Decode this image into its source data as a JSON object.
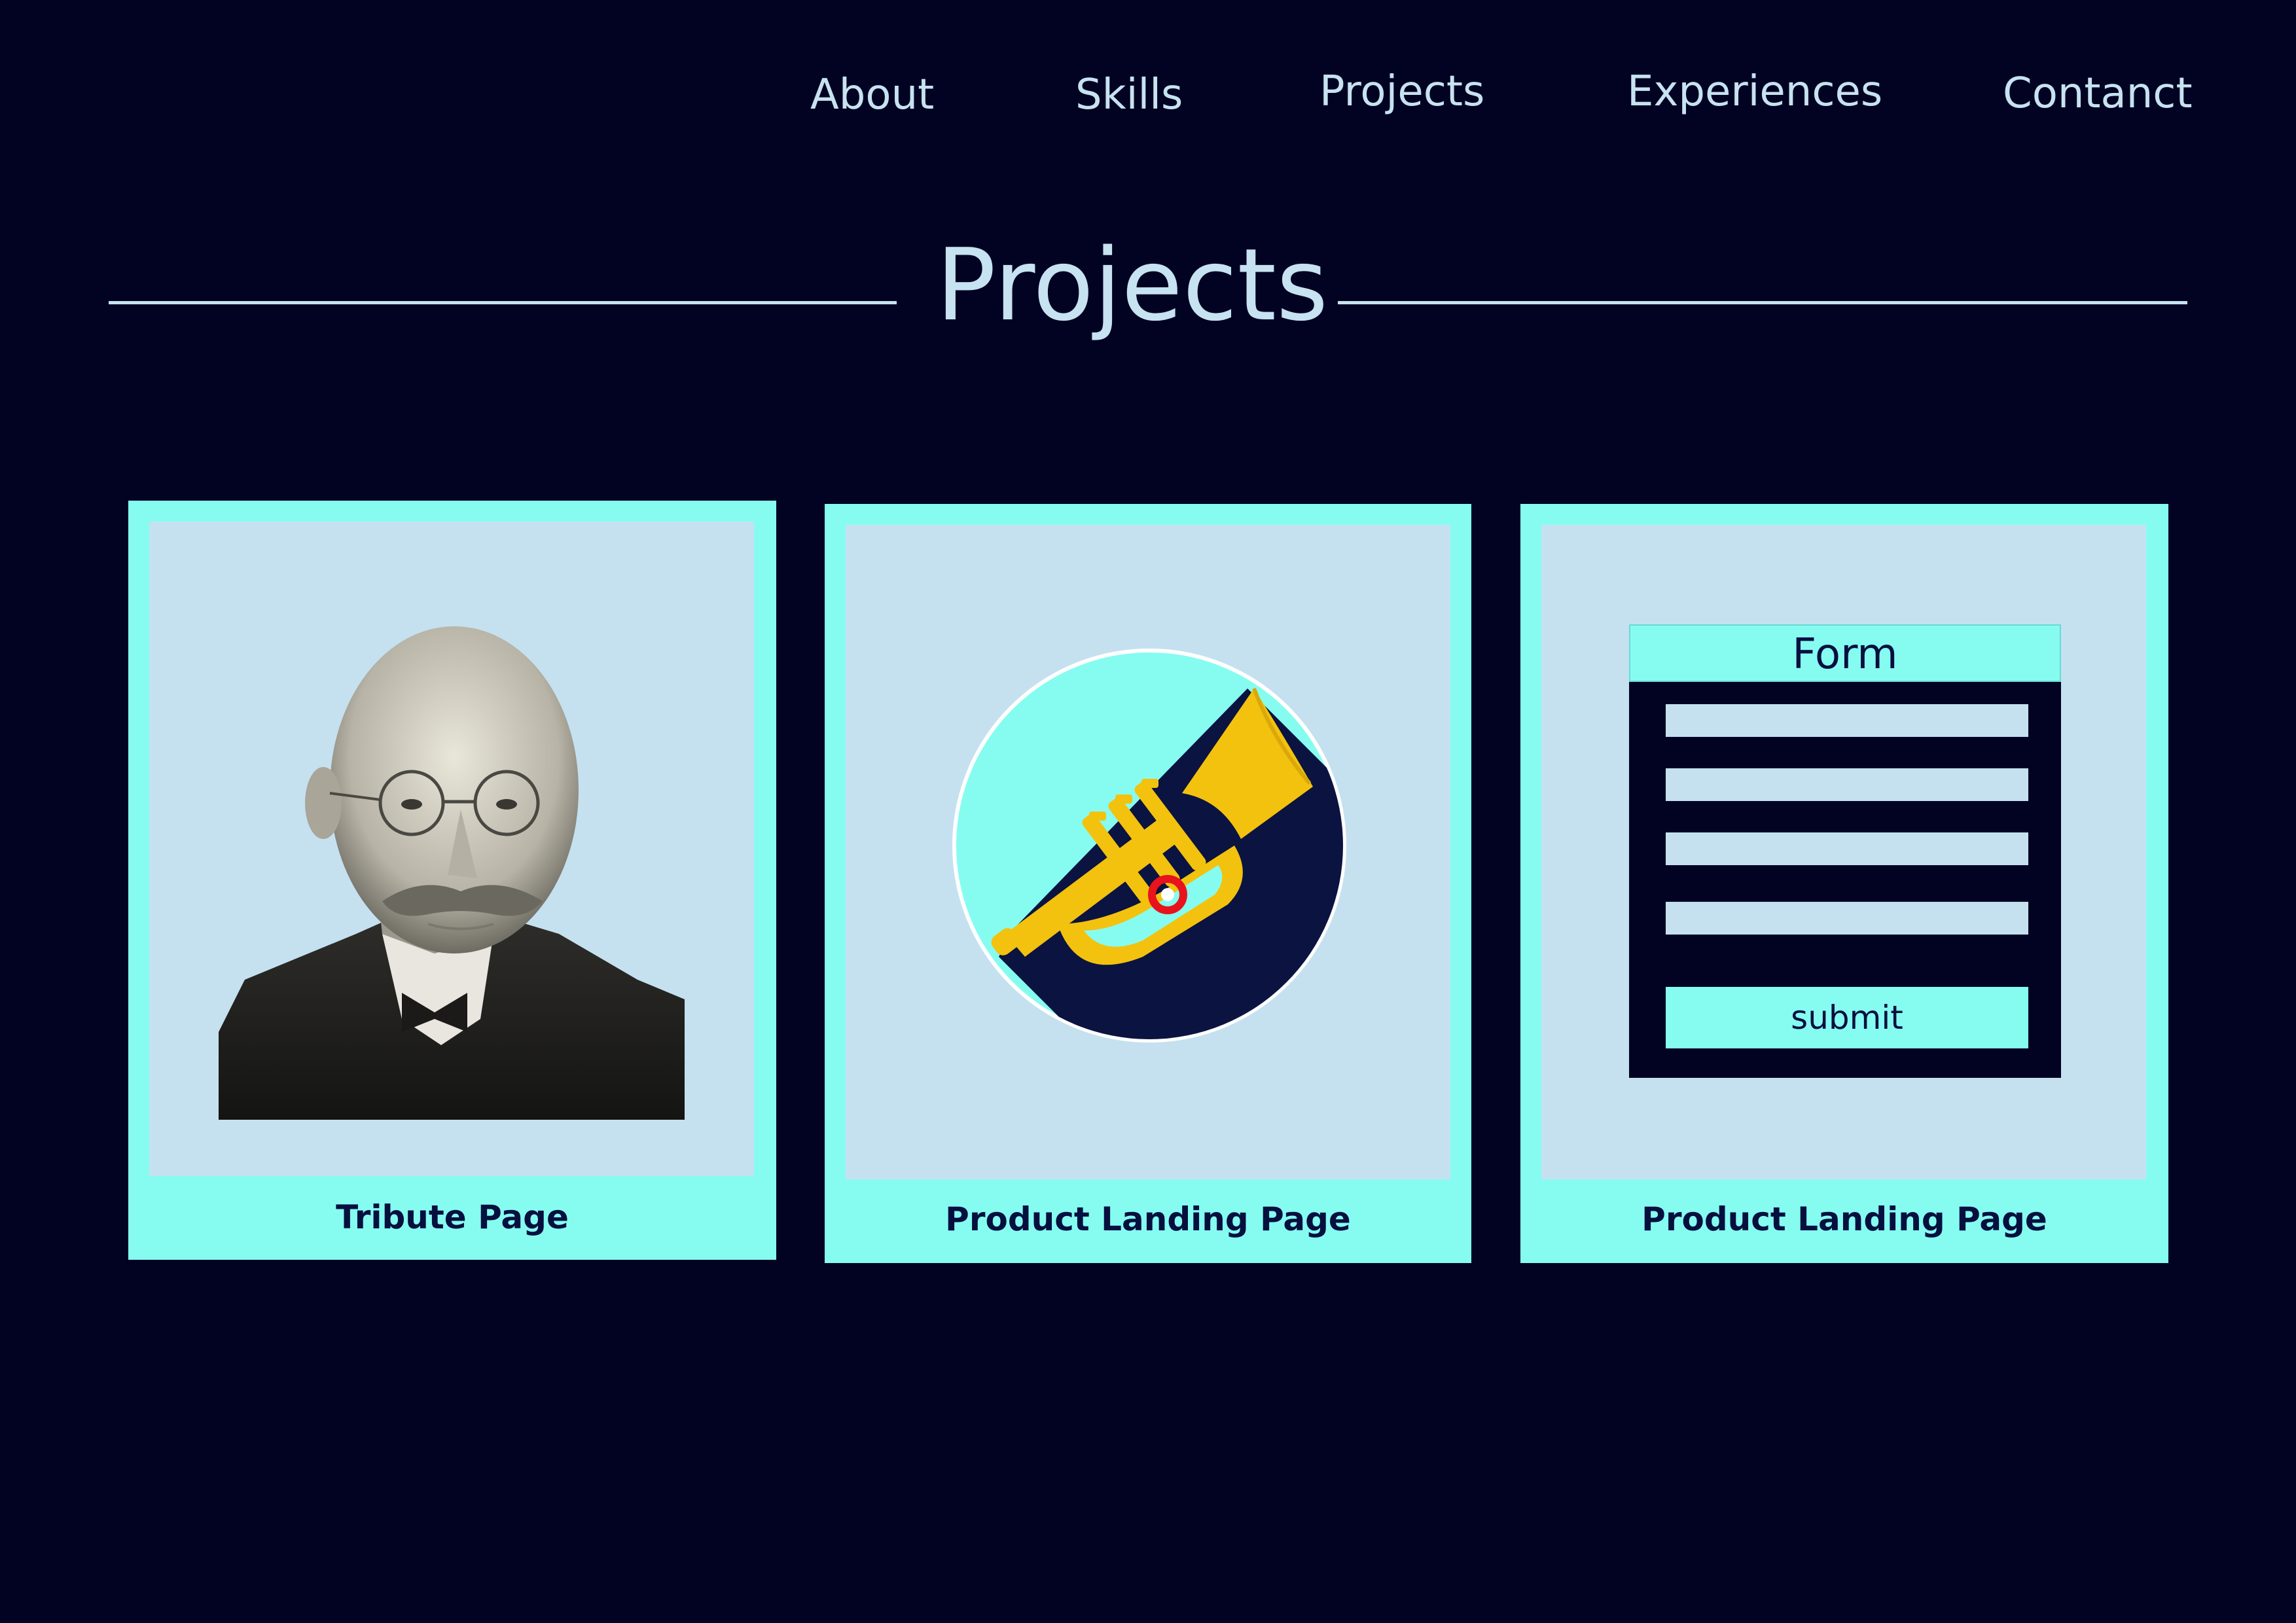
{
  "nav": {
    "items": [
      {
        "label": "About"
      },
      {
        "label": "Skills"
      },
      {
        "label": "Projects"
      },
      {
        "label": "Experiences"
      },
      {
        "label": "Contanct"
      }
    ]
  },
  "section": {
    "title": "Projects"
  },
  "projects": [
    {
      "caption": "Tribute Page",
      "thumbnail": "portrait-photo"
    },
    {
      "caption": "Product Landing Page",
      "thumbnail": "trumpet-icon"
    },
    {
      "caption": "Product Landing Page",
      "thumbnail": "form-mock",
      "form": {
        "title": "Form",
        "submit_label": "submit"
      }
    }
  ],
  "colors": {
    "background": "#020322",
    "accent": "#86fcf1",
    "panel": "#c5e1f0",
    "text_light": "#c7e2f0",
    "text_dark": "#06103f",
    "trumpet": "#f3c20f",
    "trumpet_valve_ring": "#e8131c"
  }
}
